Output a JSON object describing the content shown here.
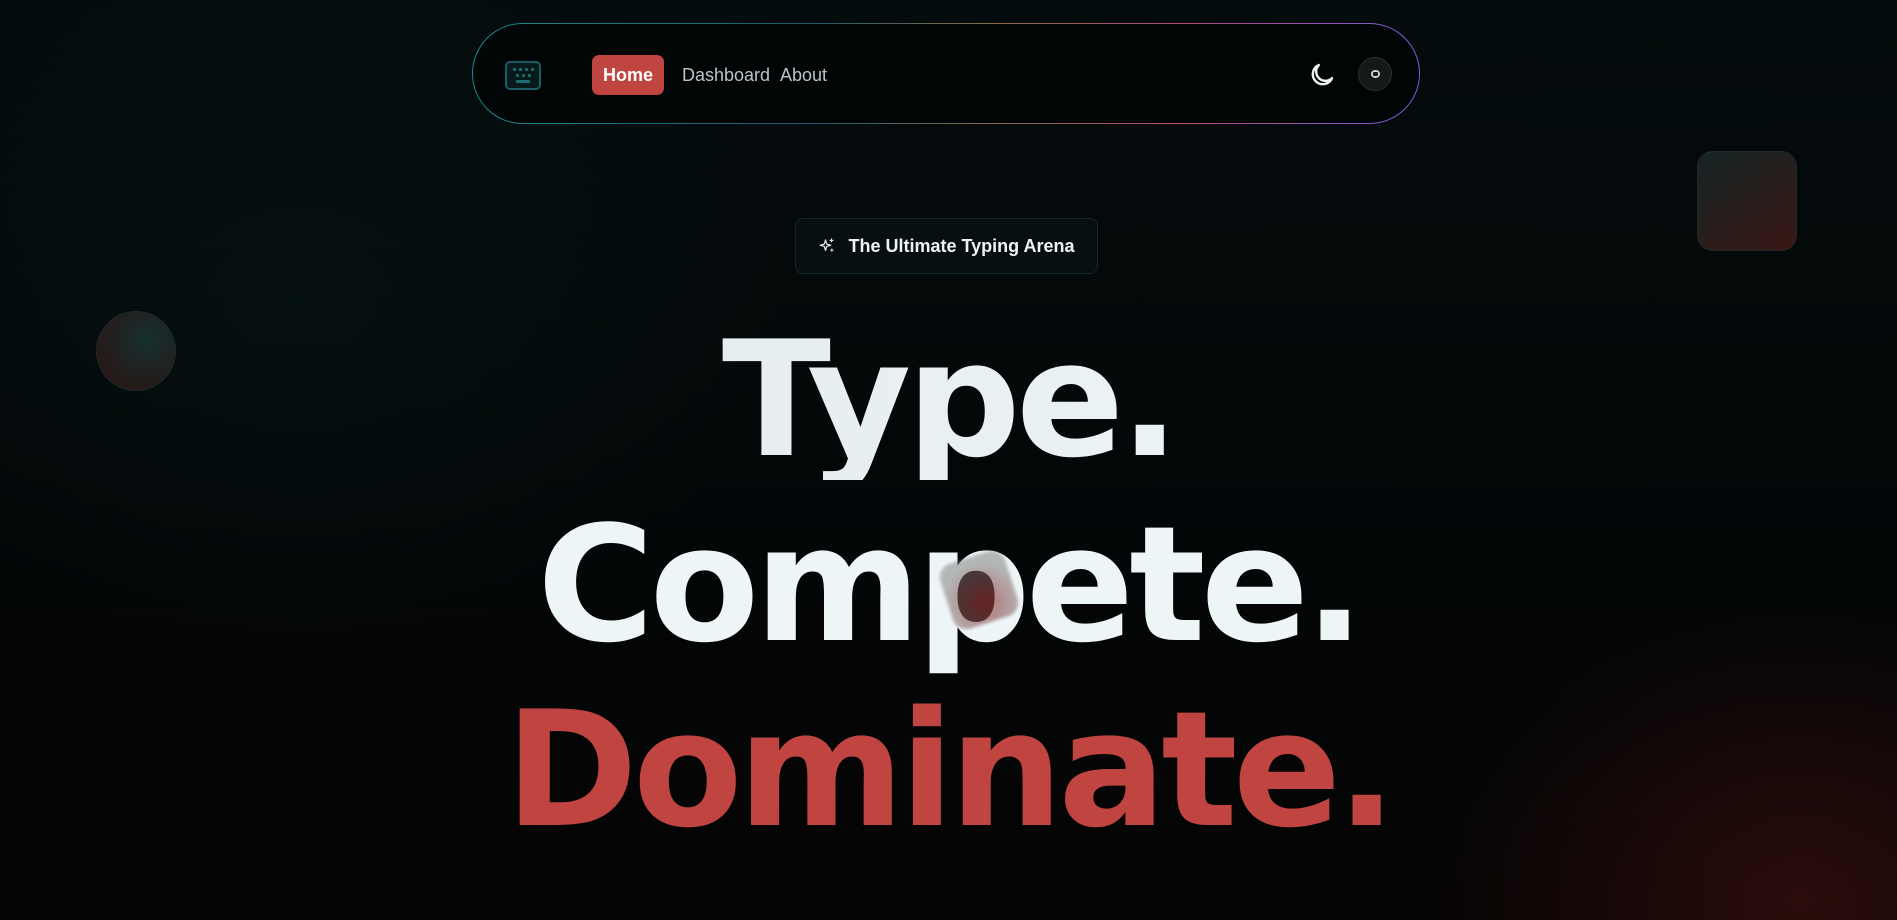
{
  "nav": {
    "logo_icon": "keyboard-icon",
    "links": [
      {
        "label": "Home",
        "active": true
      },
      {
        "label": "Dashboard",
        "active": false
      },
      {
        "label": "About",
        "active": false
      }
    ],
    "theme_toggle_icon": "moon-icon",
    "avatar_icon": "user-avatar"
  },
  "badge": {
    "icon": "sparkles-icon",
    "text": "The Ultimate Typing Arena"
  },
  "hero": {
    "line1": "Type.",
    "line2": "Compete.",
    "line3": "Dominate."
  },
  "colors": {
    "accent": "#c0443f",
    "background": "#030607",
    "headline_light": "#eef5f6",
    "nav_border_start": "#17898f",
    "nav_border_end": "#7b5ce0"
  }
}
